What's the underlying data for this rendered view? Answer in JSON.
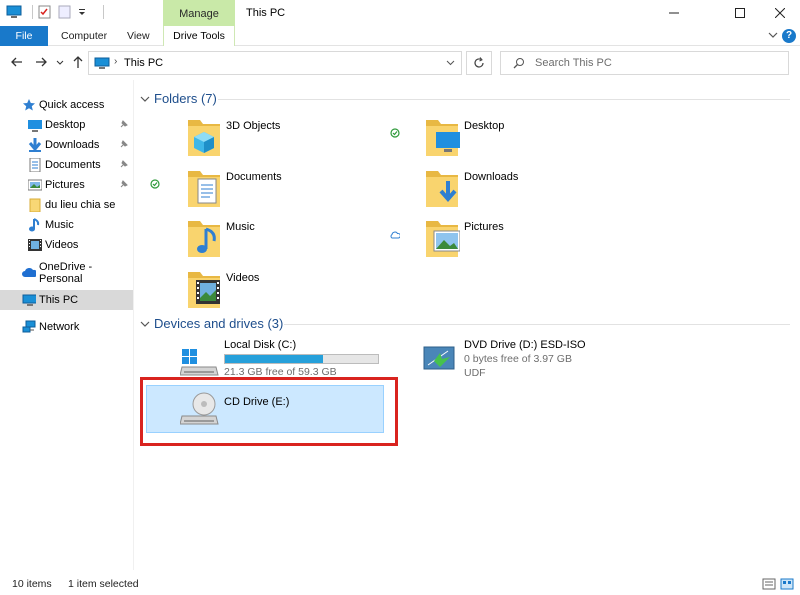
{
  "window": {
    "title": "This PC",
    "contextual_tab": "Manage",
    "buttons": [
      "minimize",
      "maximize",
      "close"
    ]
  },
  "ribbon": {
    "tabs": [
      "File",
      "Computer",
      "View",
      "Drive Tools"
    ]
  },
  "address": {
    "path": "This PC",
    "search_placeholder": "Search This PC"
  },
  "nav": {
    "quick_access": "Quick access",
    "items": [
      {
        "label": "Desktop",
        "icon": "desktop-icon",
        "pinned": true
      },
      {
        "label": "Downloads",
        "icon": "downloads-icon",
        "pinned": true
      },
      {
        "label": "Documents",
        "icon": "documents-icon",
        "pinned": true
      },
      {
        "label": "Pictures",
        "icon": "pictures-icon",
        "pinned": true
      },
      {
        "label": "du lieu chia se",
        "icon": "folder-icon",
        "pinned": false
      },
      {
        "label": "Music",
        "icon": "music-icon",
        "pinned": false
      },
      {
        "label": "Videos",
        "icon": "videos-icon",
        "pinned": false
      }
    ],
    "onedrive": "OneDrive - Personal",
    "this_pc": "This PC",
    "network": "Network"
  },
  "folders": {
    "header": "Folders (7)",
    "items": [
      {
        "label": "3D Objects",
        "icon": "3d-objects-icon"
      },
      {
        "label": "Desktop",
        "icon": "desktop-icon",
        "status": "synced-check"
      },
      {
        "label": "Documents",
        "icon": "documents-icon",
        "status": "synced-check"
      },
      {
        "label": "Downloads",
        "icon": "downloads-icon"
      },
      {
        "label": "Music",
        "icon": "music-icon"
      },
      {
        "label": "Pictures",
        "icon": "pictures-icon",
        "status": "cloud"
      },
      {
        "label": "Videos",
        "icon": "videos-icon"
      }
    ]
  },
  "drives": {
    "header": "Devices and drives (3)",
    "items": [
      {
        "name": "Local Disk (C:)",
        "free": "21.3 GB free of 59.3 GB",
        "used_fraction": 0.64
      },
      {
        "name": "DVD Drive (D:) ESD-ISO",
        "free": "0 bytes free of 3.97 GB",
        "fs": "UDF"
      },
      {
        "name": "CD Drive (E:)",
        "selected": true
      }
    ]
  },
  "status": {
    "count": "10 items",
    "selection": "1 item selected"
  },
  "colors": {
    "accent": "#1979ca",
    "manage": "#c9e9a8",
    "selection": "#cce8ff",
    "highlight_box": "#d9231f",
    "bar_fill": "#26a0da"
  }
}
